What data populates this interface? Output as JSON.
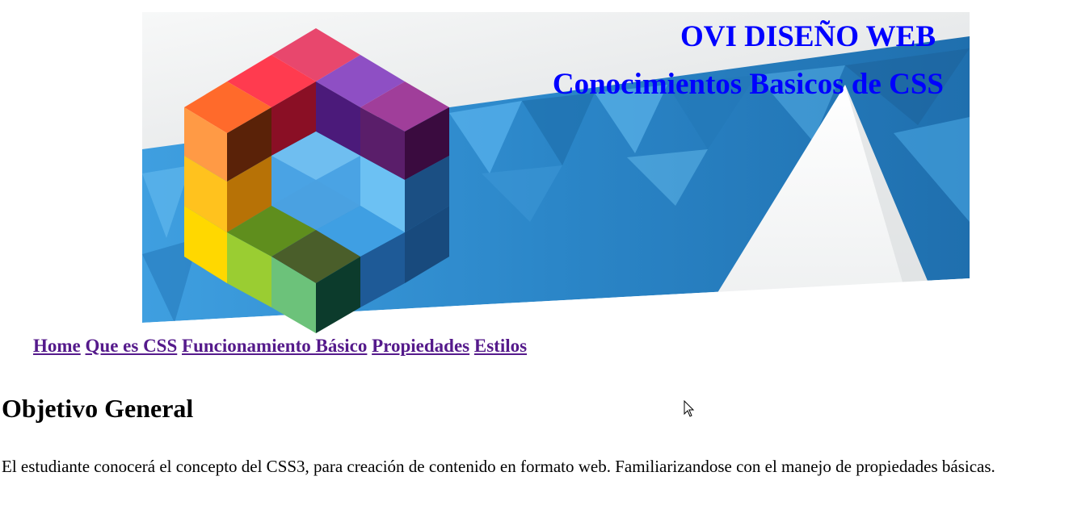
{
  "header": {
    "title": "OVI DISEÑO WEB",
    "subtitle": "Conocimientos Basicos de CSS"
  },
  "nav": {
    "items": [
      {
        "label": "Home"
      },
      {
        "label": "Que es CSS"
      },
      {
        "label": "Funcionamiento Básico"
      },
      {
        "label": "Propiedades"
      },
      {
        "label": "Estilos"
      }
    ]
  },
  "main": {
    "heading": "Objetivo General",
    "paragraph": "El estudiante conocerá el concepto del CSS3, para creación de contenido en formato web. Familiarizandose con el manejo de propiedades básicas."
  },
  "colors": {
    "title": "#0000ff",
    "link_visited": "#551a8b",
    "banner_blue": "#2a86c9"
  },
  "icons": {
    "logo": "colorful-cube-logo-icon",
    "cursor": "mouse-pointer-icon"
  }
}
